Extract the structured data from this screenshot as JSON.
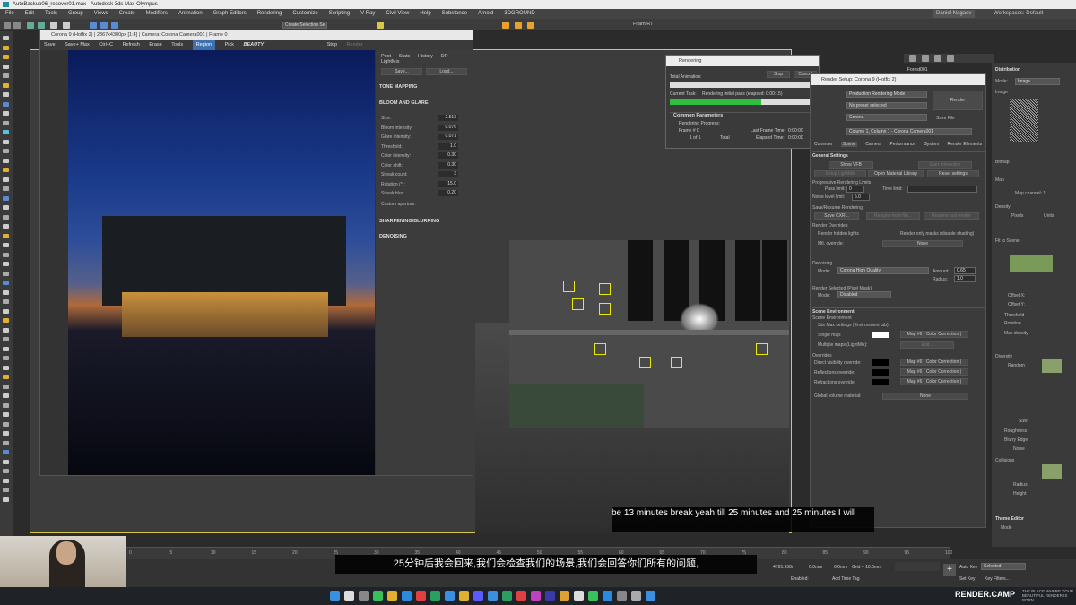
{
  "app": {
    "window_title": "AutoBackup06_recover01.max - Autodesk 3ds Max Olympus",
    "menu": [
      "File",
      "Edit",
      "Tools",
      "Group",
      "Views",
      "Create",
      "Modifiers",
      "Animation",
      "Graph Editors",
      "Rendering",
      "Customize",
      "Scripting",
      "V-Ray",
      "Civil View",
      "Help",
      "Substance",
      "Arnold",
      "3DGROUND"
    ],
    "user": "Daniel Nagaev",
    "workspaces_label": "Workspaces: Default",
    "filter_label": "Fifam RT",
    "selection_set": "Create Selection Se"
  },
  "vfb": {
    "title": "Corona 9 (Hotfix 2) | 2867x4300px [1:4] | Camera: Corona Camera001 | Frame 0",
    "toolbar": [
      "Save",
      "Save+ Max",
      "Ctrl+C",
      "Refresh",
      "Erase",
      "Tools",
      "Region",
      "Pick",
      "BEAUTY",
      "Stop",
      "Render"
    ],
    "panel_tabs": [
      "Post",
      "Stats",
      "History",
      "DR",
      "LightMix"
    ],
    "save_btn": "Save...",
    "load_btn": "Load...",
    "sections": {
      "tone_mapping": "TONE MAPPING",
      "bloom_glare": "BLOOM AND GLARE",
      "sharpening": "SHARPENING/BLURRING",
      "denoising": "DENOISING"
    },
    "bloom_rows": [
      {
        "label": "Size:",
        "value": "2.513"
      },
      {
        "label": "Bloom intensity:",
        "value": "0.076"
      },
      {
        "label": "Glare intensity:",
        "value": "0.071"
      },
      {
        "label": "Threshold:",
        "value": "1.0"
      },
      {
        "label": "Color intensity:",
        "value": "0.30"
      },
      {
        "label": "Color shift:",
        "value": "0.30"
      },
      {
        "label": "Streak count:",
        "value": "3"
      },
      {
        "label": "Rotation (°):",
        "value": "15.0"
      },
      {
        "label": "Streak blur:",
        "value": "0.20"
      }
    ],
    "custom_aperture": "Custom aperture:"
  },
  "rendering_dialog": {
    "title": "Rendering",
    "stop_btn": "Stop",
    "cancel_btn": "Cancel",
    "total_animation": "Total Animation:",
    "current_task_label": "Current Task:",
    "current_task": "Rendering initial pass (elapsed: 0:00:15)",
    "progress": 0.62,
    "common_params": "Common Parameters",
    "rendering_progress": "Rendering Progress:",
    "frame_label": "Frame #",
    "frame_value": "0",
    "of_label": "1 of 1",
    "total_label": "Total",
    "last_frame_time_label": "Last Frame Time:",
    "last_frame_time": "0:00:00",
    "elapsed_time_label": "Elapsed Time:",
    "elapsed_time": "0:00:00"
  },
  "render_setup": {
    "title": "Render Setup: Corona 9 (Hotfix 2)",
    "mode": "Production Rendering Mode",
    "preset": "No preset selected",
    "renderer": "Corona",
    "save_file": "Save File",
    "render_btn": "Render",
    "render_target": "Column 1, Column 1 - Corona Camera001",
    "tabs": [
      "Common",
      "Scene",
      "Camera",
      "Performance",
      "System",
      "Render Elements"
    ],
    "general_settings": "General Settings",
    "show_vfb": "Show VFB",
    "start_interactive": "Start interactive",
    "setup_lightmix": "Setup LightMix",
    "open_material_library": "Open Material Library",
    "reset_settings": "Reset settings",
    "progressive_limits": "Progressive Rendering Limits",
    "pass_limit_label": "Pass limit:",
    "pass_limit": "0",
    "time_limit_label": "Time limit:",
    "noise_level_label": "Noise level limit:",
    "noise_level": "5.0",
    "save_resume": "Save/Resume Rendering",
    "save_cxr": "Save CXR...",
    "resume_from_file": "Resume from file...",
    "resume_last": "Resume last render",
    "render_overrides": "Render Overrides",
    "render_hidden_lights": "Render hidden lights",
    "render_only_masks": "Render only masks (disable shading)",
    "mtl_override": "Mtl. override:",
    "none1": "None",
    "denoising": "Denoising",
    "denoise_mode_label": "Mode:",
    "denoise_mode": "Corona High Quality",
    "amount_label": "Amount:",
    "amount": "0.65",
    "radius_label": "Radius:",
    "radius": "1.0",
    "render_selected": "Render Selected (Pixel Mask)",
    "rs_mode": "Disabled",
    "scene_env": "Scene Environment",
    "scene_env_sub": "Scene Environment",
    "max_settings": "3ds Max settings (Environment tab)",
    "single_map": "Single map:",
    "map1": "Map #6 ( Color Correction )",
    "multiple_maps": "Multiple maps (LightMix):",
    "edit": "Edit...",
    "overrides": "Overrides",
    "direct_vis": "Direct visibility override:",
    "map2": "Map #6 ( Color Correction )",
    "refl_override": "Reflections override:",
    "map3": "Map #6 ( Color Correction )",
    "refr_override": "Refractions override:",
    "map4": "Map #6 ( Color Correction )",
    "global_volume": "Global volume material:",
    "none2": "None"
  },
  "right_panel": {
    "object_name": "Forest001",
    "distribution": "Distribution",
    "mode_label": "Mode:",
    "mode": "Image",
    "image_label": "Image",
    "bitmap": "Bitmap",
    "map": "Map",
    "map_channel": "Map channel: 1",
    "density": "Density",
    "pixels": "Pixels",
    "units": "Units",
    "fit_to_scene": "Fit to Scene",
    "offset_x": "Offset X:",
    "offset_y": "Offset Y:",
    "threshold": "Threshold",
    "rotation": "Rotation",
    "max_density": "Max density",
    "diversity": "Diversity",
    "random": "Random",
    "size": "Size",
    "roughness": "Roughness",
    "blurry_edge": "Blurry Edge",
    "noise": "Noise",
    "collisions": "Collisions",
    "c_radius": "Radius",
    "c_height": "Height",
    "theme_editor": "Theme Editor",
    "te_mode": "Mode"
  },
  "status": {
    "grid": "Grid = 10.0mm",
    "auto_key": "Auto Key",
    "selected": "Selected",
    "set_key": "Set Key",
    "key_filters": "Key Filters...",
    "add_time_tag": "Add Time Tag",
    "enabled": "Enabled:",
    "x_coord": "4795.938r",
    "y_coord": "0.0mm",
    "z_coord": "0.0mm"
  },
  "timeline_ticks": [
    "0",
    "5",
    "10",
    "15",
    "20",
    "25",
    "30",
    "35",
    "40",
    "45",
    "50",
    "55",
    "60",
    "65",
    "70",
    "75",
    "80",
    "85",
    "90",
    "95",
    "100"
  ],
  "subtitle_en": "be 13 minutes break yeah till 25 minutes and 25 minutes I will",
  "subtitle_zh": "25分钟后我会回来,我们会检查我们的场景,我们会回答你们所有的问题,",
  "brand": "RENDER.CAMP",
  "brand_tag": "THE PLACE WHERE YOUR BEAUTIFUL RENDER IS BORN",
  "colors": {
    "accent": "#3d6fb3",
    "progress": "#2fbf3f",
    "selection": "#d8c84a"
  }
}
